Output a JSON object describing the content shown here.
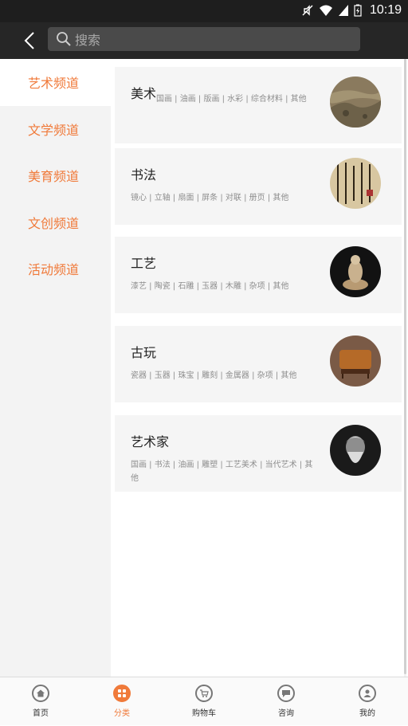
{
  "status_bar": {
    "time": "10:19"
  },
  "search": {
    "placeholder": "搜索"
  },
  "sidebar": {
    "items": [
      {
        "label": "艺术频道",
        "active": true
      },
      {
        "label": "文学频道",
        "active": false
      },
      {
        "label": "美育频道",
        "active": false
      },
      {
        "label": "文创频道",
        "active": false
      },
      {
        "label": "活动频道",
        "active": false
      }
    ]
  },
  "categories": [
    {
      "title": "美术",
      "sub": "国画 | 油画 | 版画 | 水彩 | 综合材料 | 其他",
      "image": "landscape-painting"
    },
    {
      "title": "书法",
      "sub": "镜心 | 立轴 | 扇面 | 屏条 | 对联 | 册页 | 其他",
      "image": "calligraphy-scroll"
    },
    {
      "title": "工艺",
      "sub": "漆艺 | 陶瓷 | 石雕 | 玉器 | 木雕 | 杂项 | 其他",
      "image": "carved-figure"
    },
    {
      "title": "古玩",
      "sub": "瓷器 | 玉器 | 珠宝 | 雕刻 | 金属器 | 杂项 | 其他",
      "image": "antique-box"
    },
    {
      "title": "艺术家",
      "sub": "国画 | 书法 | 油画 | 雕塑 | 工艺美术 | 当代艺术 | 其他",
      "image": "artist-portrait"
    }
  ],
  "tabbar": {
    "items": [
      {
        "label": "首页",
        "icon": "home-icon"
      },
      {
        "label": "分类",
        "icon": "category-icon",
        "active": true
      },
      {
        "label": "购物车",
        "icon": "cart-icon"
      },
      {
        "label": "咨询",
        "icon": "chat-icon"
      },
      {
        "label": "我的",
        "icon": "user-icon"
      }
    ]
  },
  "colors": {
    "accent": "#f07a3a",
    "topbar": "#262626",
    "statusbar": "#1e1e1e"
  }
}
